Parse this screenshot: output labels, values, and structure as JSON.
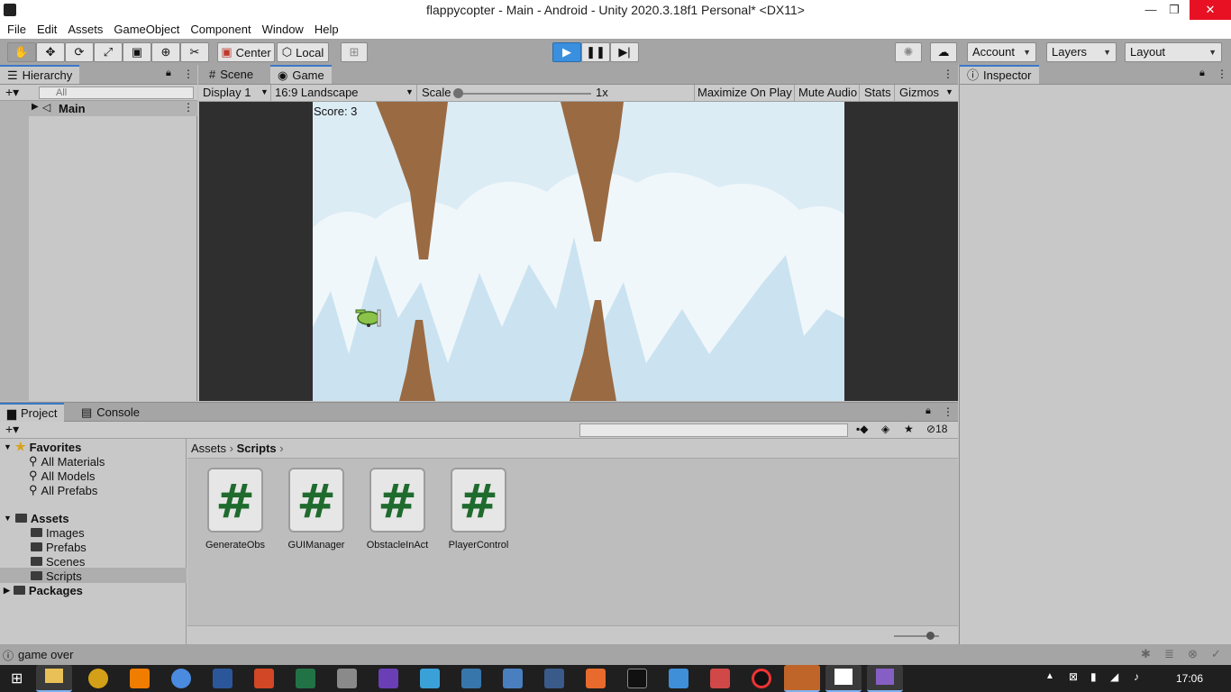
{
  "window": {
    "title": "flappycopter - Main - Android - Unity 2020.3.18f1 Personal* <DX11>",
    "minimize": "—",
    "restore": "❐",
    "close": "✕"
  },
  "menu": [
    "File",
    "Edit",
    "Assets",
    "GameObject",
    "Component",
    "Window",
    "Help"
  ],
  "toolbar": {
    "pivot": "Center",
    "space": "Local",
    "account": "Account",
    "layers": "Layers",
    "layout": "Layout"
  },
  "hierarchy": {
    "tab": "Hierarchy",
    "search_placeholder": "All",
    "scene_item": "Main"
  },
  "game_view": {
    "tabs": [
      "Scene",
      "Game"
    ],
    "display": "Display 1",
    "aspect": "16:9 Landscape",
    "scale_label": "Scale",
    "scale_value": "1x",
    "scale_level": 0.0,
    "options": [
      "Maximize On Play",
      "Mute Audio",
      "Stats",
      "Gizmos"
    ],
    "score_text": "Score: 3"
  },
  "inspector": {
    "tab": "Inspector"
  },
  "project": {
    "tabs": [
      "Project",
      "Console"
    ],
    "hidden_count": "18",
    "favorites": {
      "label": "Favorites",
      "items": [
        "All Materials",
        "All Models",
        "All Prefabs"
      ]
    },
    "assets": {
      "label": "Assets",
      "folders": [
        "Images",
        "Prefabs",
        "Scenes",
        "Scripts"
      ]
    },
    "packages": "Packages",
    "breadcrumb": [
      "Assets",
      "Scripts"
    ],
    "files": [
      "GenerateObs",
      "GUIManager",
      "ObstacleInAct",
      "PlayerControl"
    ]
  },
  "status": {
    "message": "game over"
  },
  "taskbar": {
    "time": "17:06"
  },
  "colors": {
    "play_button": "#3a8fde",
    "sky": "#dcecf5",
    "rock": "#9a6a43",
    "script_icon": "#1f6b2e"
  }
}
